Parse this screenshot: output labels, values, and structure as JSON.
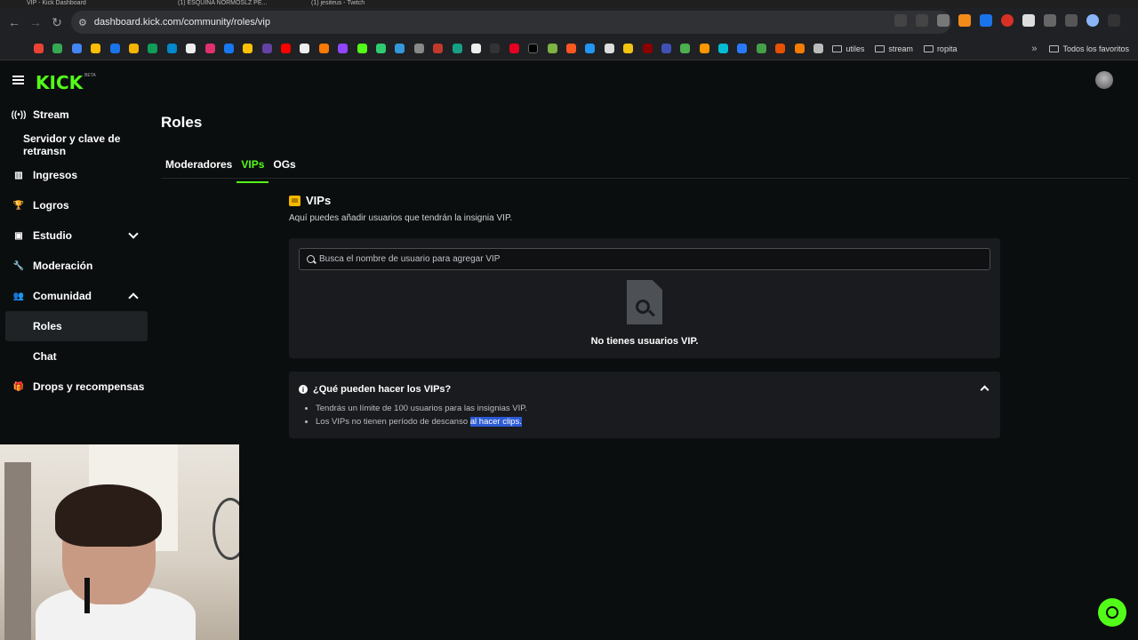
{
  "browser": {
    "tabs": [
      "VIP - Kick Dashboard",
      "(1) ESQUINA NORMOSLZ PE...",
      "(1) jesiteus - Twitch"
    ],
    "url": "dashboard.kick.com/community/roles/vip",
    "bookmark_folders": [
      "utiles",
      "stream",
      "ropita"
    ],
    "all_bookmarks": "Todos los favoritos"
  },
  "app": {
    "logo": "KICK",
    "logo_badge": "BETA"
  },
  "sidebar": {
    "items": [
      {
        "label": "Stream"
      },
      {
        "label": "Servidor y clave de retransn"
      },
      {
        "label": "Ingresos"
      },
      {
        "label": "Logros"
      },
      {
        "label": "Estudio"
      },
      {
        "label": "Moderación"
      },
      {
        "label": "Comunidad"
      },
      {
        "label": "Roles"
      },
      {
        "label": "Chat"
      },
      {
        "label": "Drops y recompensas"
      }
    ]
  },
  "main": {
    "title": "Roles",
    "tabs": [
      {
        "label": "Moderadores"
      },
      {
        "label": "VIPs"
      },
      {
        "label": "OGs"
      }
    ],
    "section_title": "VIPs",
    "section_desc": "Aquí puedes añadir usuarios que tendrán la insignia VIP.",
    "search_placeholder": "Busca el nombre de usuario para agregar VIP",
    "empty_text": "No tienes usuarios VIP.",
    "faq": {
      "question": "¿Qué pueden hacer los VIPs?",
      "items": [
        "Tendrás un límite de 100 usuarios para las insignias VIP.",
        "Los VIPs no tienen período de descanso",
        "al hacer clips."
      ]
    }
  },
  "colors": {
    "accent": "#53fc18",
    "background": "#0b0e0f",
    "card": "#191b1f",
    "highlight": "#2d5bd4"
  }
}
